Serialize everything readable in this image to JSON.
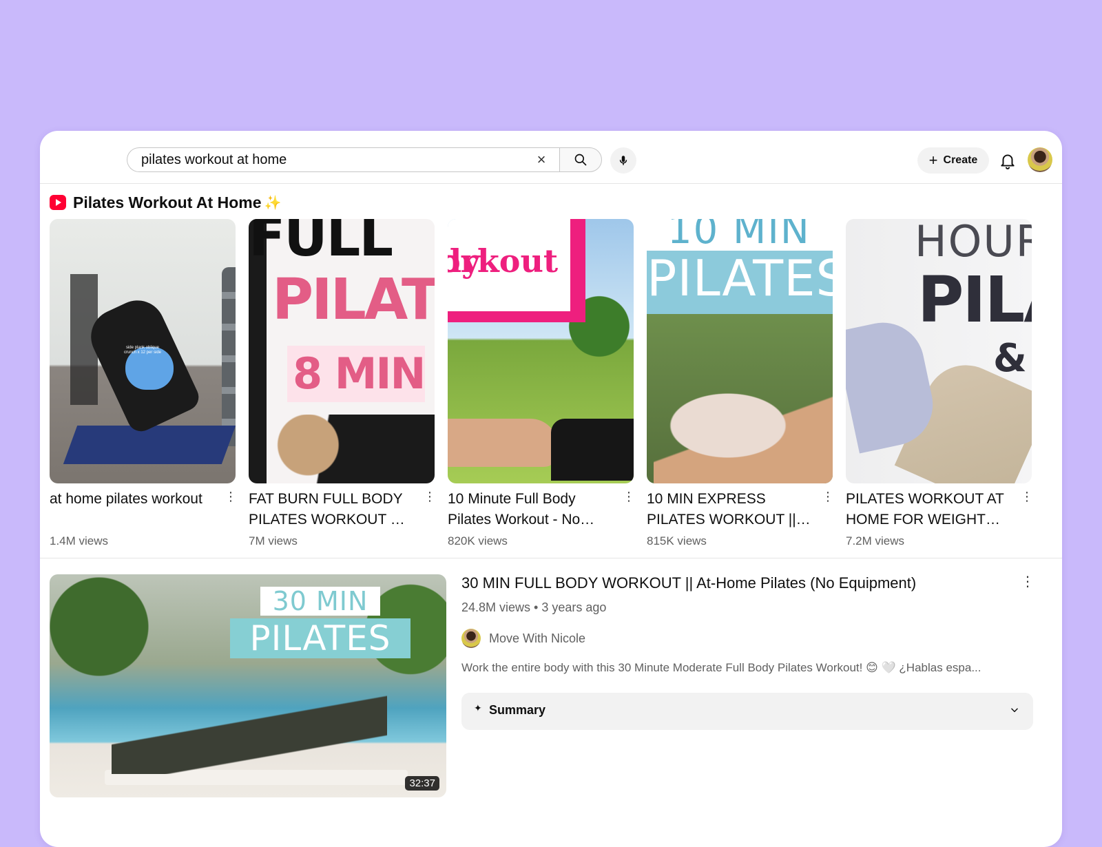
{
  "search": {
    "value": "pilates workout at home",
    "clear_glyph": "×"
  },
  "header": {
    "create_label": "Create",
    "create_glyph": "+"
  },
  "shelf": {
    "title": "Pilates Workout At Home",
    "sparkle": "✨",
    "shorts": [
      {
        "title": "at home pilates workout",
        "views": "1.4M views",
        "thumb_text": "side plank oblique crunch x 12 per side"
      },
      {
        "title": "FAT BURN FULL BODY PILATES WORKOUT 🔥 …",
        "views": "7M views",
        "thumb_text": [
          "FULL",
          "PILAT",
          "8 MIN"
        ]
      },
      {
        "title": "10 Minute Full Body Pilates Workout - No…",
        "views": "820K views",
        "thumb_text": [
          "dy",
          "orkout"
        ]
      },
      {
        "title": "10 MIN EXPRESS PILATES WORKOUT || A…",
        "views": "815K views",
        "thumb_text": [
          "10 MIN",
          "PILATES"
        ]
      },
      {
        "title": "PILATES WORKOUT AT HOME FOR WEIGHT…",
        "views": "7.2M views",
        "thumb_text": [
          "HOUR",
          "PILA",
          "&"
        ]
      }
    ]
  },
  "video": {
    "title": "30 MIN FULL BODY WORKOUT || At-Home Pilates (No Equipment)",
    "meta": "24.8M views • 3 years ago",
    "channel": "Move With Nicole",
    "description": "Work the entire body with this 30 Minute Moderate Full Body Pilates Workout! 😊 🤍 ¿Hablas espa...",
    "duration": "32:37",
    "thumb_text": [
      "30 MIN",
      "PILATES"
    ],
    "summary_label": "Summary"
  },
  "colors": {
    "background": "#c9b9fb",
    "yt_red": "#ff0033",
    "text_primary": "#0f0f0f",
    "text_secondary": "#606060"
  },
  "icons": [
    "clear-icon",
    "search-icon",
    "mic-icon",
    "plus-icon",
    "bell-icon",
    "avatar",
    "youtube-shorts-icon",
    "kebab-icon",
    "sparkle-icon",
    "chevron-down-icon"
  ]
}
